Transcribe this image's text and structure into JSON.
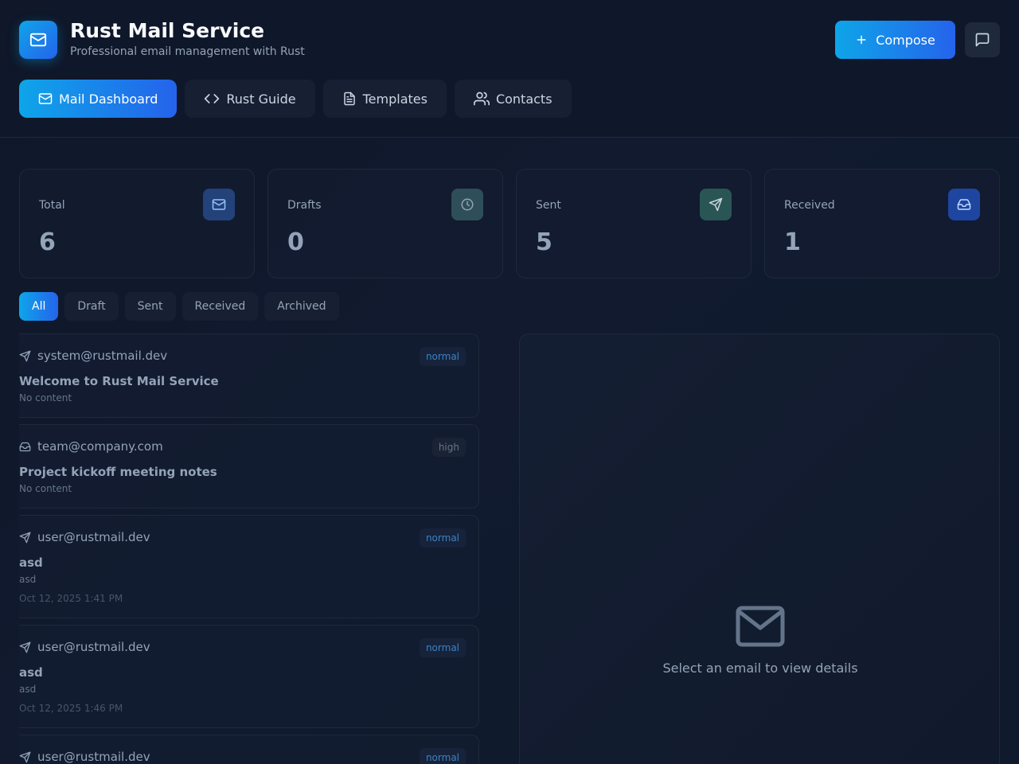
{
  "header": {
    "title": "Rust Mail Service",
    "subtitle": "Professional email management with Rust",
    "compose_label": "Compose",
    "logo_icon": "mail-icon",
    "chat_icon": "message-square-icon"
  },
  "nav": {
    "tabs": [
      {
        "label": "Mail Dashboard",
        "icon": "mail-icon",
        "active": true
      },
      {
        "label": "Rust Guide",
        "icon": "code-icon",
        "active": false
      },
      {
        "label": "Templates",
        "icon": "file-text-icon",
        "active": false
      },
      {
        "label": "Contacts",
        "icon": "users-icon",
        "active": false
      }
    ]
  },
  "stats": [
    {
      "label": "Total",
      "value": "6",
      "icon": "mail-icon",
      "color": "#2563eb"
    },
    {
      "label": "Drafts",
      "value": "0",
      "icon": "clock-icon",
      "color": "#475569"
    },
    {
      "label": "Sent",
      "value": "5",
      "icon": "send-icon",
      "color": "#2f5a5a"
    },
    {
      "label": "Received",
      "value": "1",
      "icon": "inbox-icon",
      "color": "#1d4ed8"
    }
  ],
  "filters": [
    {
      "label": "All",
      "active": true
    },
    {
      "label": "Draft",
      "active": false
    },
    {
      "label": "Sent",
      "active": false
    },
    {
      "label": "Received",
      "active": false
    },
    {
      "label": "Archived",
      "active": false
    }
  ],
  "emails": [
    {
      "address": "system@rustmail.dev",
      "icon": "send-icon",
      "priority": "normal",
      "subject": "Welcome to Rust Mail Service",
      "preview": "No content",
      "date": ""
    },
    {
      "address": "team@company.com",
      "icon": "inbox-icon",
      "priority": "high",
      "subject": "Project kickoff meeting notes",
      "preview": "No content",
      "date": ""
    },
    {
      "address": "user@rustmail.dev",
      "icon": "send-icon",
      "priority": "normal",
      "subject": "asd",
      "preview": "asd",
      "date": "Oct 12, 2025 1:41 PM"
    },
    {
      "address": "user@rustmail.dev",
      "icon": "send-icon",
      "priority": "normal",
      "subject": "asd",
      "preview": "asd",
      "date": "Oct 12, 2025 1:46 PM"
    },
    {
      "address": "user@rustmail.dev",
      "icon": "send-icon",
      "priority": "normal",
      "subject": "",
      "preview": "",
      "date": ""
    }
  ],
  "detail": {
    "empty_text": "Select an email to view details",
    "icon": "mail-icon"
  },
  "colors": {
    "accent_start": "#0ea5e9",
    "accent_end": "#2563eb",
    "background": "#0f172a"
  }
}
